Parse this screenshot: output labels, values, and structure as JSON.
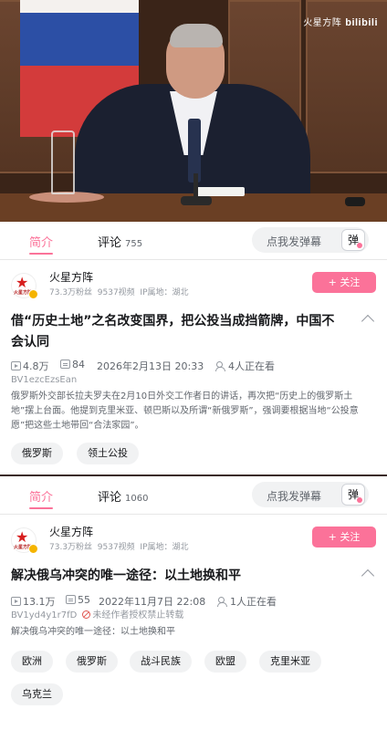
{
  "video": {
    "watermark_text": "火星方阵",
    "watermark_logo": "bilibili"
  },
  "card1": {
    "tabs": {
      "intro": "简介",
      "comment": "评论",
      "comment_count": "755"
    },
    "danmaku": {
      "placeholder": "点我发弹幕",
      "button": "弹"
    },
    "up": {
      "name": "火星方阵",
      "avatar_text": "火星方阵",
      "fans": "73.3万粉丝",
      "videos": "9537视频",
      "ip": "IP属地：湖北",
      "follow_label": "+ 关注"
    },
    "title": "借“历史土地”之名改变国界，把公投当成挡箭牌，中国不会认同",
    "stats": {
      "views": "4.8万",
      "danmaku": "84",
      "date": "2026年2月13日 20:33",
      "watching": "4人正在看"
    },
    "bvid": "BV1ezcEzsEan",
    "description": "俄罗斯外交部长拉夫罗夫在2月10日外交工作者日的讲话，再次把“历史上的俄罗斯土地”摆上台面。他提到克里米亚、顿巴斯以及所谓“新俄罗斯”，强调要根据当地“公投意愿”把这些土地带回“合法家园”。",
    "tags": [
      "俄罗斯",
      "领土公投"
    ]
  },
  "card2": {
    "tabs": {
      "intro": "简介",
      "comment": "评论",
      "comment_count": "1060"
    },
    "danmaku": {
      "placeholder": "点我发弹幕",
      "button": "弹"
    },
    "up": {
      "name": "火星方阵",
      "avatar_text": "火星方阵",
      "fans": "73.3万粉丝",
      "videos": "9537视频",
      "ip": "IP属地：湖北",
      "follow_label": "+ 关注"
    },
    "title": "解决俄乌冲突的唯一途径：以土地换和平",
    "stats": {
      "views": "13.1万",
      "danmaku": "55",
      "date": "2022年11月7日 22:08",
      "watching": "1人正在看"
    },
    "bvid": "BV1yd4y1r7fD",
    "no_reprint": "未经作者授权禁止转载",
    "description": "解决俄乌冲突的唯一途径：以土地换和平",
    "tags": [
      "欧洲",
      "俄罗斯",
      "战斗民族",
      "欧盟",
      "克里米亚",
      "乌克兰"
    ]
  }
}
